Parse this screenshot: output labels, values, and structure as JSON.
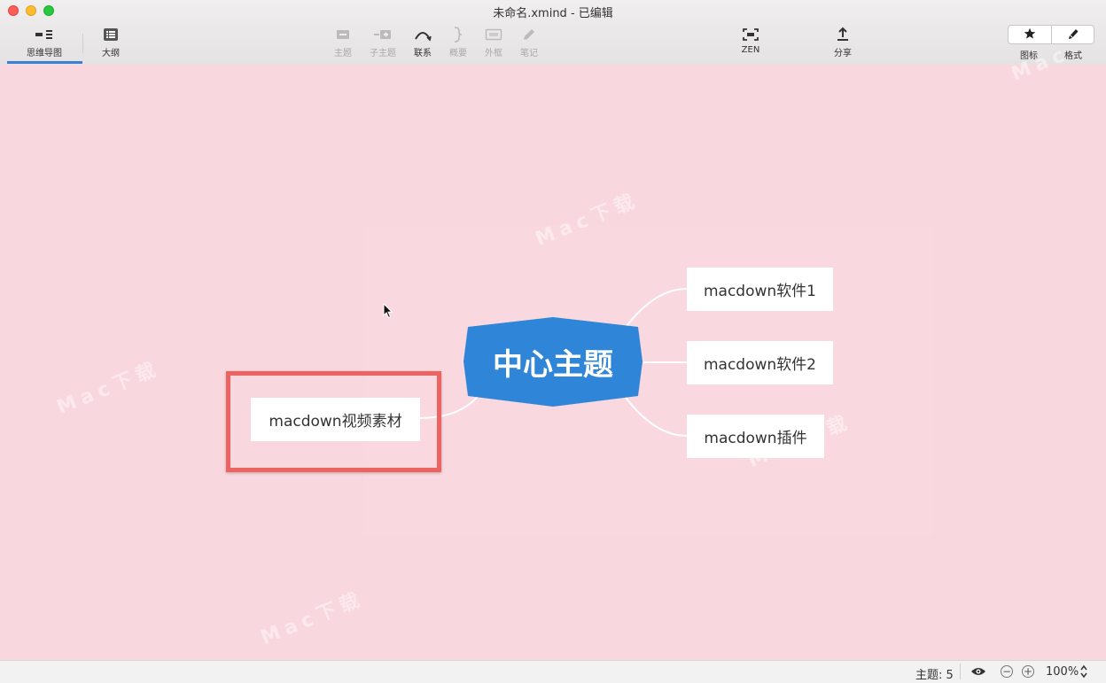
{
  "window": {
    "title": "未命名.xmind - 已编辑"
  },
  "toolbar": {
    "left_tabs": [
      {
        "label": "思维导图",
        "icon": "mindmap-icon",
        "active": true
      },
      {
        "label": "大纲",
        "icon": "outline-icon",
        "active": false
      }
    ],
    "center_tools": [
      {
        "label": "主题",
        "icon": "topic-icon",
        "enabled": false
      },
      {
        "label": "子主题",
        "icon": "subtopic-icon",
        "enabled": false
      },
      {
        "label": "联系",
        "icon": "relationship-icon",
        "enabled": true
      },
      {
        "label": "概要",
        "icon": "summary-brace-icon",
        "enabled": false
      },
      {
        "label": "外框",
        "icon": "boundary-icon",
        "enabled": false
      },
      {
        "label": "笔记",
        "icon": "note-pencil-icon",
        "enabled": false
      }
    ],
    "zen_label": "ZEN",
    "share_label": "分享",
    "icons_label": "图标",
    "format_label": "格式"
  },
  "mindmap": {
    "central_topic": "中心主题",
    "central_color": "#2f86d9",
    "topics": [
      {
        "label": "macdown软件1"
      },
      {
        "label": "macdown软件2"
      },
      {
        "label": "macdown插件"
      },
      {
        "label": "macdown视频素材",
        "selected": true
      }
    ],
    "selection_color": "#ec6362",
    "canvas_color": "#f9d7de"
  },
  "statusbar": {
    "topic_count": "主题: 5",
    "zoom": "100%"
  }
}
